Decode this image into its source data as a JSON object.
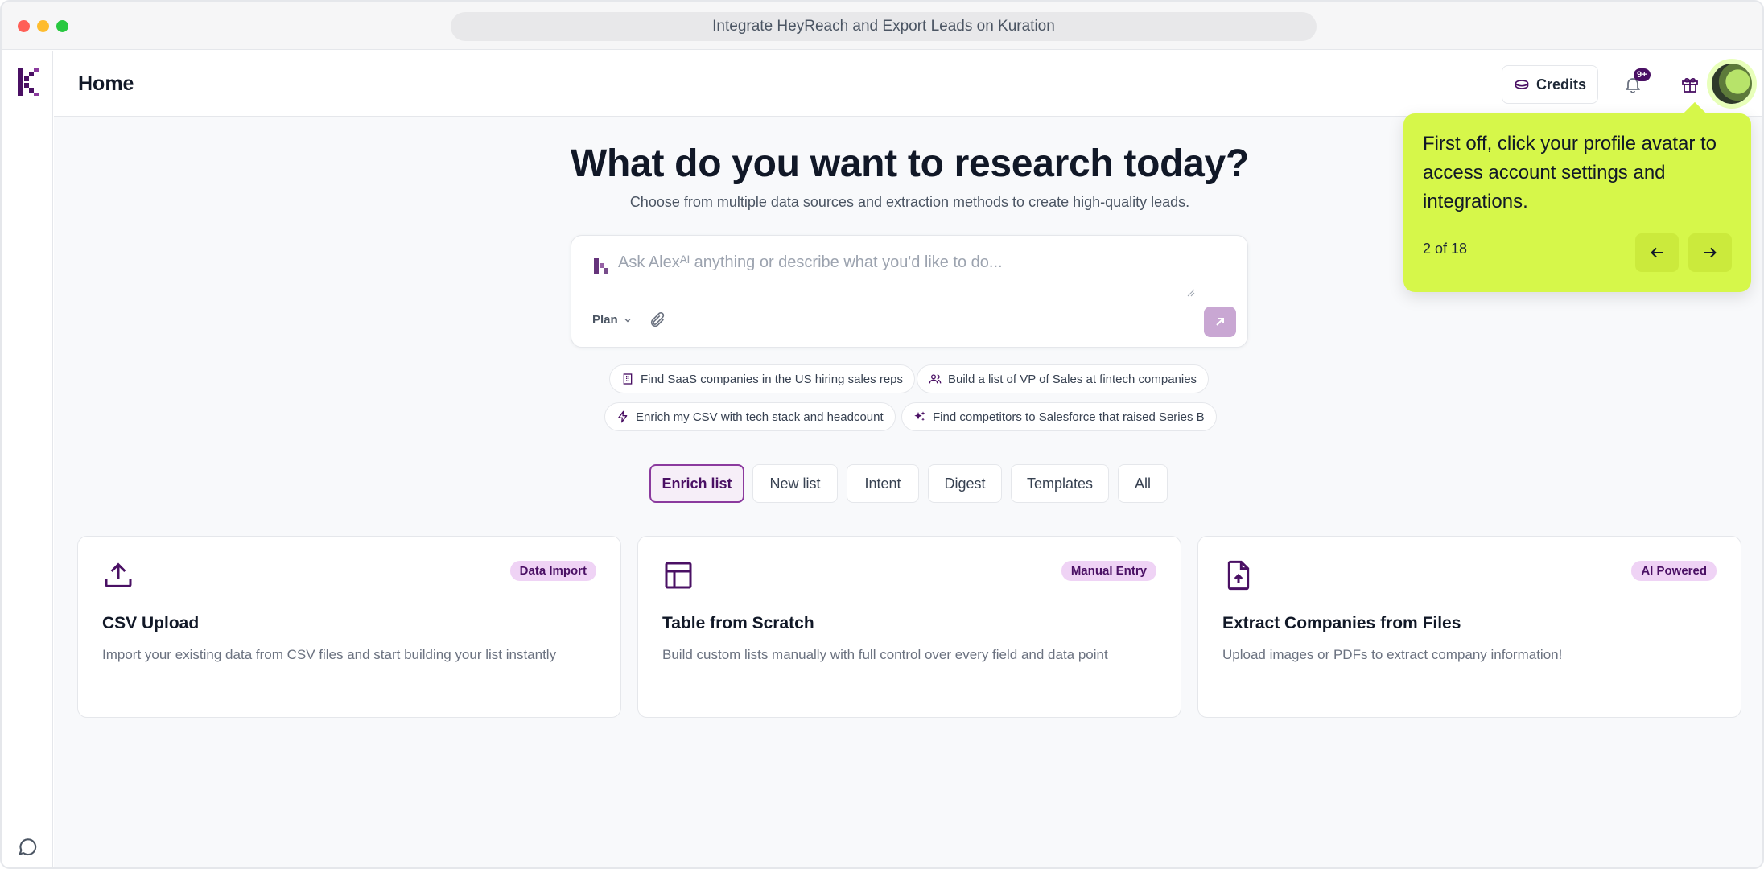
{
  "window": {
    "url_title": "Integrate HeyReach and Export Leads on Kuration"
  },
  "header": {
    "title": "Home",
    "credits_label": "Credits",
    "notification_badge": "9+"
  },
  "hero": {
    "title": "What do you want to research today?",
    "subtitle": "Choose from multiple data sources and extraction methods to create high-quality leads."
  },
  "ask": {
    "placeholder": "Ask Alexᴬᴵ anything or describe what you'd like to do...",
    "plan_label": "Plan"
  },
  "suggestions": [
    {
      "icon": "building-icon",
      "label": "Find SaaS companies in the US hiring sales reps"
    },
    {
      "icon": "users-icon",
      "label": "Build a list of VP of Sales at fintech companies"
    },
    {
      "icon": "lightning-icon",
      "label": "Enrich my CSV with tech stack and headcount"
    },
    {
      "icon": "sparkles-icon",
      "label": "Find competitors to Salesforce that raised Series B"
    }
  ],
  "tabs": [
    {
      "label": "Enrich list",
      "active": true
    },
    {
      "label": "New list",
      "active": false
    },
    {
      "label": "Intent",
      "active": false
    },
    {
      "label": "Digest",
      "active": false
    },
    {
      "label": "Templates",
      "active": false
    },
    {
      "label": "All",
      "active": false
    }
  ],
  "cards": [
    {
      "icon": "upload-icon",
      "badge": "Data Import",
      "title": "CSV Upload",
      "description": "Import your existing data from CSV files and start building your list instantly"
    },
    {
      "icon": "table-icon",
      "badge": "Manual Entry",
      "title": "Table from Scratch",
      "description": "Build custom lists manually with full control over every field and data point"
    },
    {
      "icon": "file-upload-icon",
      "badge": "AI Powered",
      "title": "Extract Companies from Files",
      "description": "Upload images or PDFs to extract company information!"
    }
  ],
  "tooltip": {
    "text": "First off, click your profile avatar to access account settings and integrations.",
    "step": "2 of 18"
  },
  "colors": {
    "accent": "#4a1064",
    "tooltip_bg": "#d6f74a",
    "badge_bg": "#efd3f5"
  }
}
